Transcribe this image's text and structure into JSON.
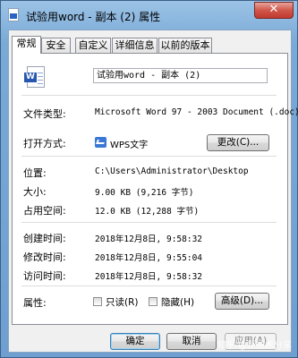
{
  "window": {
    "title": "试验用word - 副本 (2) 属性",
    "close_label": "✕"
  },
  "tabs": [
    {
      "label": "常规",
      "active": true
    },
    {
      "label": "安全",
      "active": false
    },
    {
      "label": "自定义",
      "active": false
    },
    {
      "label": "详细信息",
      "active": false
    },
    {
      "label": "以前的版本",
      "active": false
    }
  ],
  "general": {
    "file_name": "试验用word - 副本 (2)",
    "file_type_label": "文件类型:",
    "file_type_value": "Microsoft Word 97 - 2003 Document (.doc)",
    "open_with_label": "打开方式:",
    "open_with_app": "WPS文字",
    "change_button": "更改(C)...",
    "location_label": "位置:",
    "location_value": "C:\\Users\\Administrator\\Desktop",
    "size_label": "大小:",
    "size_value": "9.00 KB (9,216 字节)",
    "size_on_disk_label": "占用空间:",
    "size_on_disk_value": "12.0 KB (12,288 字节)",
    "created_label": "创建时间:",
    "created_value": "2018年12月8日, 9:58:32",
    "modified_label": "修改时间:",
    "modified_value": "2018年12月8日, 9:55:04",
    "accessed_label": "访问时间:",
    "accessed_value": "2018年12月8日, 9:58:32",
    "attributes_label": "属性:",
    "readonly_label": "只读(R)",
    "hidden_label": "隐藏(H)",
    "advanced_button": "高级(D)..."
  },
  "footer": {
    "ok_button": "确定",
    "cancel_button": "取消",
    "apply_button": "应用(A)",
    "watermark": "知乎 @新技术分享"
  },
  "colors": {
    "title_bar": "#79a9d6",
    "close_button": "#c2392f",
    "panel_bg": "#ffffff",
    "dialog_bg": "#f0f0f0"
  }
}
